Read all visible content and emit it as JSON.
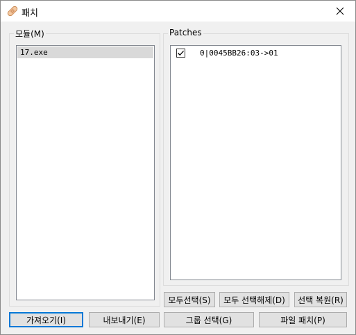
{
  "window": {
    "title": "패치",
    "close_glyph": "✕"
  },
  "modules": {
    "legend": "모듈(M)",
    "items": [
      {
        "label": "17.exe",
        "selected": true
      }
    ]
  },
  "patches": {
    "legend": "Patches",
    "items": [
      {
        "label": "0|0045BB26:03->01",
        "checked": true
      }
    ]
  },
  "buttons": {
    "select_all": "모두선택(S)",
    "deselect_all": "모두 선택해제(D)",
    "restore_selection": "선택 복원(R)",
    "import": "가져오기(I)",
    "export": "내보내기(E)",
    "group_select": "그룹 선택(G)",
    "patch_file": "파일 패치(P)"
  },
  "icons": {
    "title": "bandage-icon",
    "close": "close-icon",
    "check": "checkmark-icon"
  }
}
